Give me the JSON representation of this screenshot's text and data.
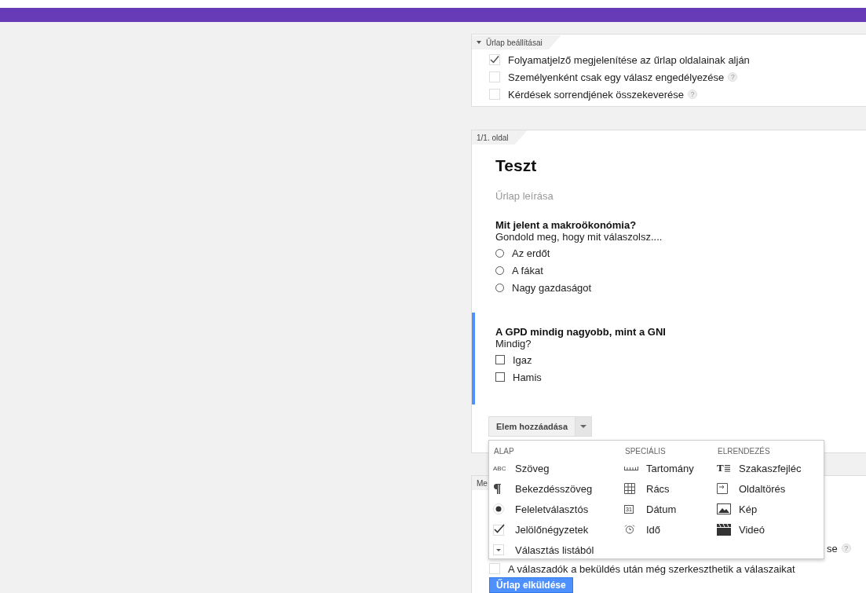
{
  "settings": {
    "title": "Űrlap beállításai",
    "expanded": true,
    "options": [
      {
        "label": "Folyamatjelző megjelenítése az űrlap oldalainak alján",
        "checked": true
      },
      {
        "label": "Személyenként csak egy válasz engedélyezése",
        "checked": false,
        "help": "?"
      },
      {
        "label": "Kérdések sorrendjének összekeverése",
        "checked": false,
        "help": "?"
      }
    ]
  },
  "page": {
    "tab": "1/1. oldal",
    "title": "Teszt",
    "description_placeholder": "Űrlap leírása",
    "questions": [
      {
        "title": "Mit jelent a makroökonómia?",
        "help_text": "Gondold meg, hogy mit válaszolsz....",
        "kind": "radio",
        "active": false,
        "options": [
          {
            "label": "Az erdőt",
            "selected": false
          },
          {
            "label": "A fákat",
            "selected": false
          },
          {
            "label": "Nagy gazdaságot",
            "selected": false
          }
        ]
      },
      {
        "title": "A GPD mindig nagyobb, mint a GNI",
        "help_text": "Mindig?",
        "kind": "checkbox",
        "active": true,
        "options": [
          {
            "label": "Igaz",
            "selected": false
          },
          {
            "label": "Hamis",
            "selected": false
          }
        ]
      }
    ],
    "add_item": "Elem hozzáadása"
  },
  "add_menu": {
    "columns": [
      {
        "heading": "ALAP",
        "items": [
          {
            "kind": "text",
            "icon_text": "ABC",
            "label": "Szöveg"
          },
          {
            "kind": "paragraph",
            "label": "Bekezdésszöveg"
          },
          {
            "kind": "radio",
            "label": "Feleletválasztós"
          },
          {
            "kind": "checkbox",
            "label": "Jelölőnégyzetek"
          },
          {
            "kind": "list",
            "label": "Választás listából"
          }
        ]
      },
      {
        "heading": "SPECIÁLIS",
        "items": [
          {
            "kind": "scale",
            "label": "Tartomány"
          },
          {
            "kind": "grid",
            "label": "Rács"
          },
          {
            "kind": "date",
            "icon_text": "31",
            "label": "Dátum"
          },
          {
            "kind": "time",
            "label": "Idő"
          }
        ]
      },
      {
        "heading": "ELRENDEZÉS",
        "items": [
          {
            "kind": "section",
            "icon_text": "T",
            "label": "Szakaszfejléc"
          },
          {
            "kind": "pagebreak",
            "label": "Oldaltörés"
          },
          {
            "kind": "image",
            "label": "Kép"
          },
          {
            "kind": "video",
            "label": "Videó"
          }
        ]
      }
    ]
  },
  "confirmation": {
    "tab": "Me",
    "options": [
      {
        "label": "se",
        "help": "?"
      },
      {
        "label": "A válaszadók a beküldés után még szerkeszthetik a válaszaikat",
        "checked": false
      }
    ],
    "submit": "Űrlap elküldése"
  }
}
